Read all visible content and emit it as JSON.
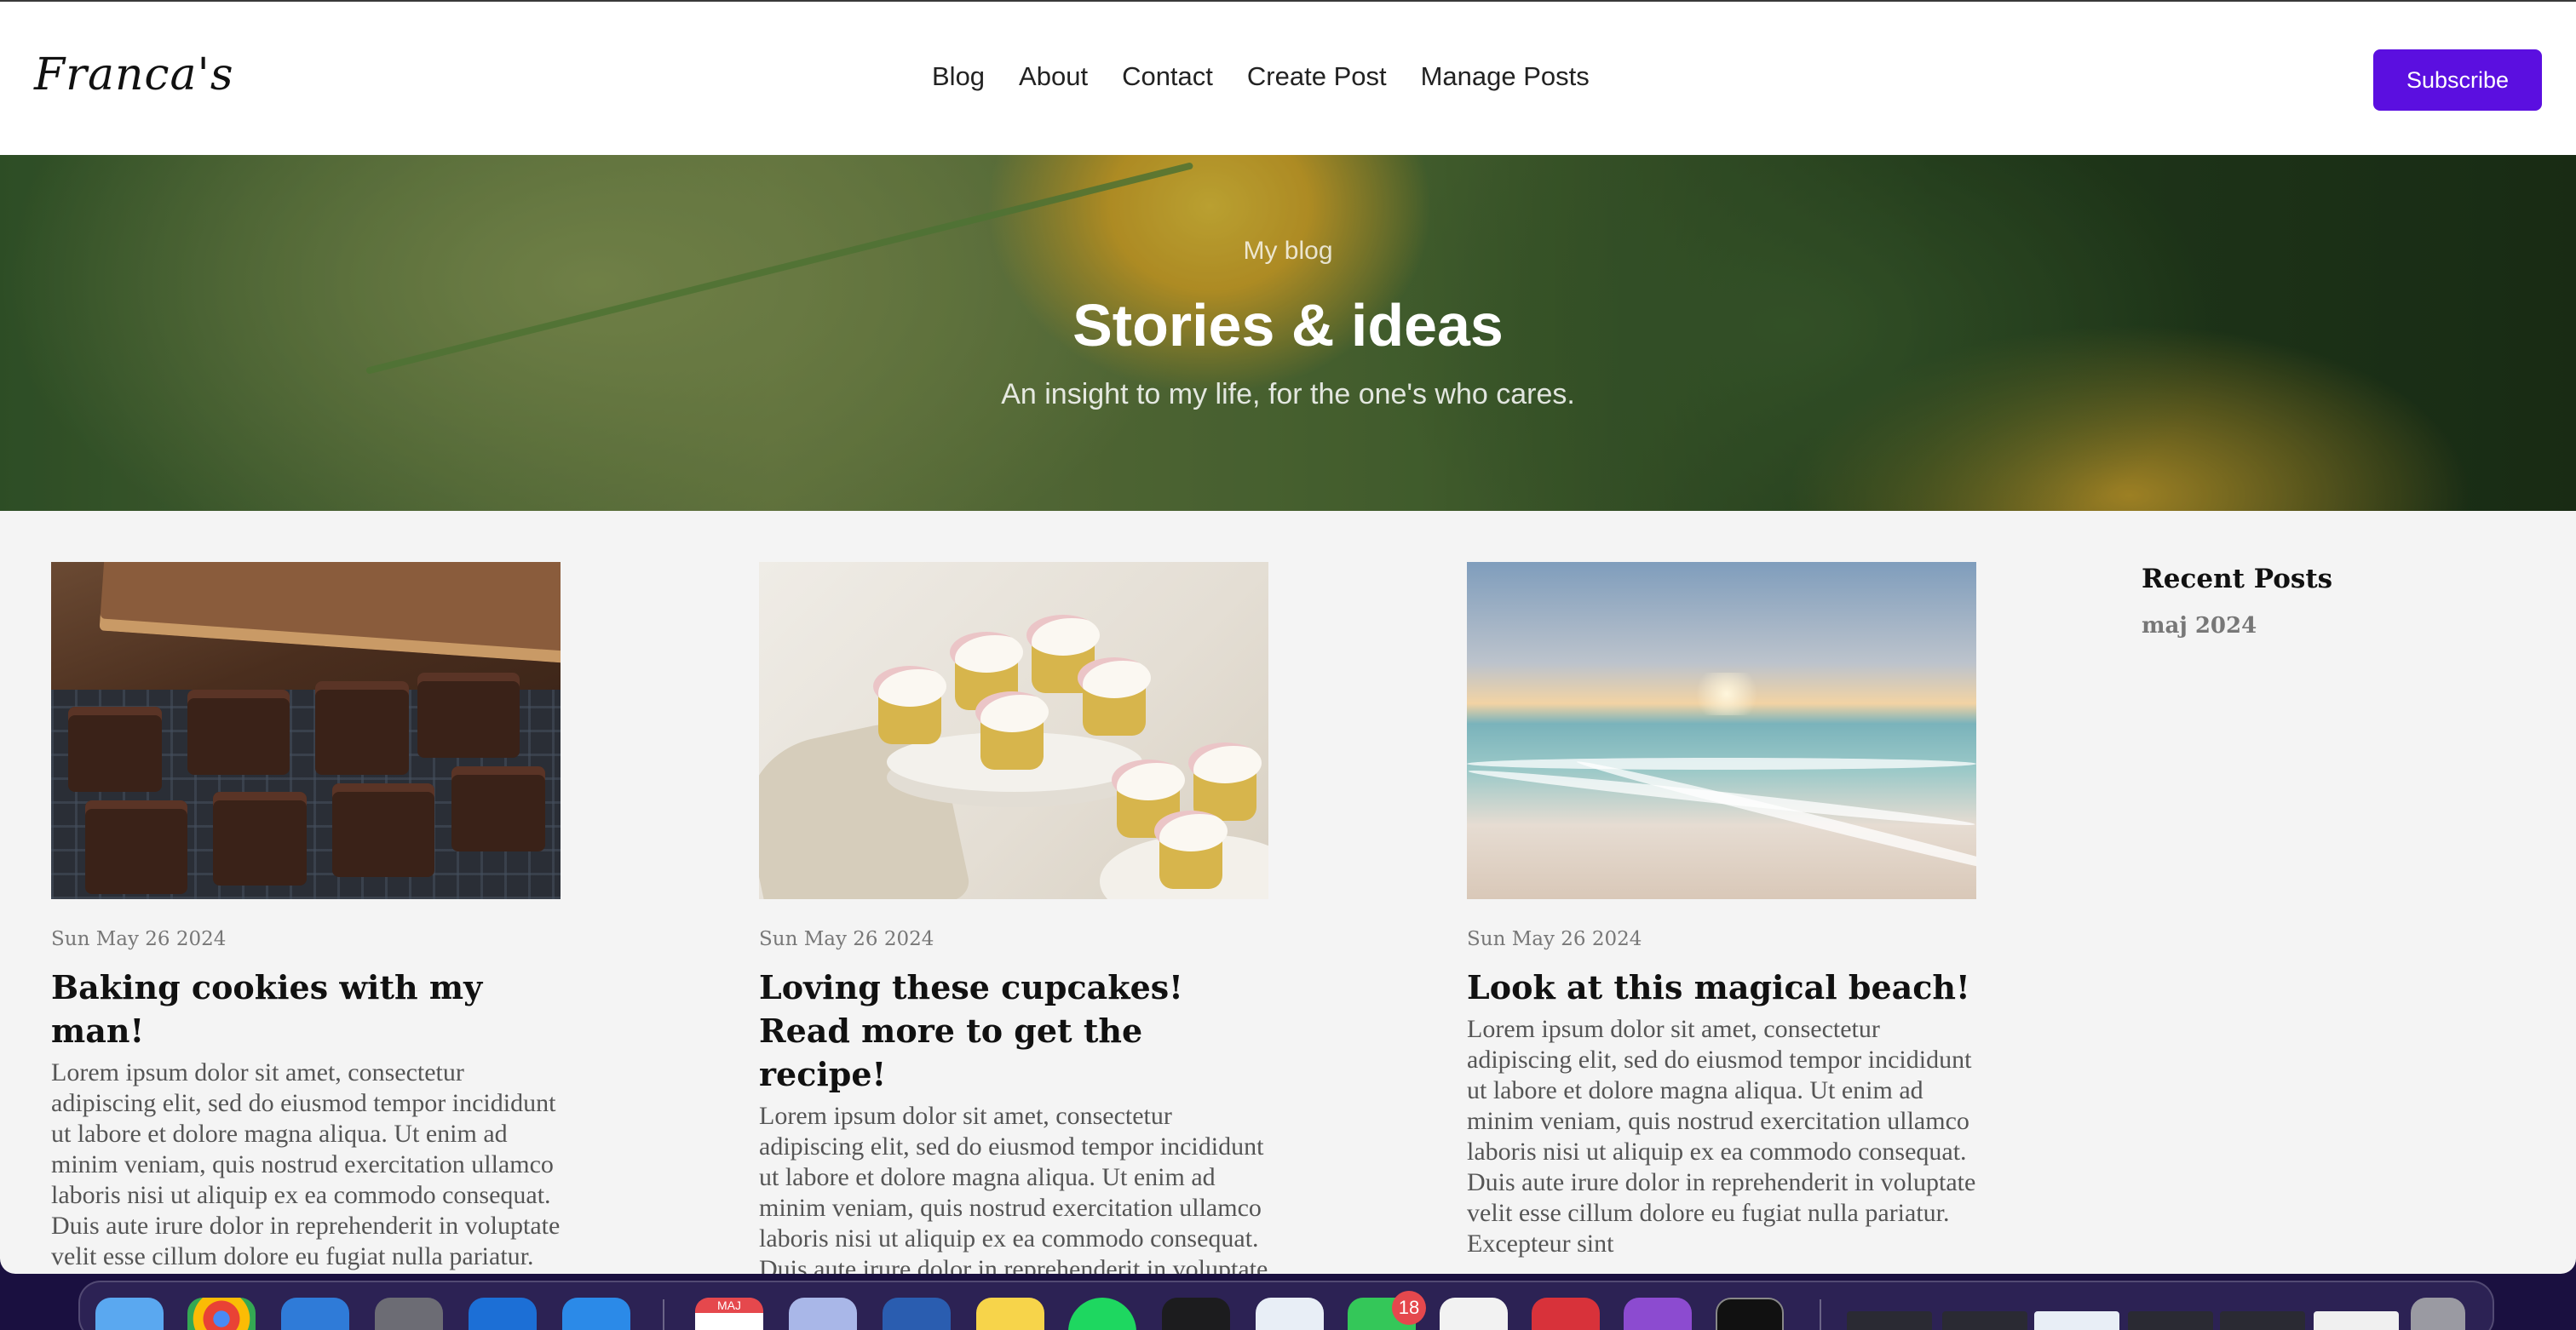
{
  "header": {
    "logo": "Franca's",
    "nav": [
      "Blog",
      "About",
      "Contact",
      "Create Post",
      "Manage Posts"
    ],
    "subscribe_label": "Subscribe"
  },
  "hero": {
    "kicker": "My blog",
    "title": "Stories & ideas",
    "subtitle": "An insight to my life, for the one's who cares."
  },
  "posts": [
    {
      "image": "brownies-photo",
      "date": "Sun May 26 2024",
      "title": "Baking cookies with my man!",
      "excerpt": "Lorem ipsum dolor sit amet, consectetur adipiscing elit, sed do eiusmod tempor incididunt ut labore et dolore magna aliqua. Ut enim ad minim veniam, quis nostrud exercitation ullamco laboris nisi ut aliquip ex ea commodo consequat. Duis aute irure dolor in reprehenderit in voluptate velit esse cillum dolore eu fugiat nulla pariatur. Excepteur sint"
    },
    {
      "image": "cupcakes-photo",
      "date": "Sun May 26 2024",
      "title": "Loving these cupcakes! Read more to get the recipe!",
      "excerpt": "Lorem ipsum dolor sit amet, consectetur adipiscing elit, sed do eiusmod tempor incididunt ut labore et dolore magna aliqua. Ut enim ad minim veniam, quis nostrud exercitation ullamco laboris nisi ut aliquip ex ea commodo consequat. Duis aute irure dolor in reprehenderit in voluptate velit esse cillum"
    },
    {
      "image": "beach-photo",
      "date": "Sun May 26 2024",
      "title": "Look at this magical beach!",
      "excerpt": "Lorem ipsum dolor sit amet, consectetur adipiscing elit, sed do eiusmod tempor incididunt ut labore et dolore magna aliqua. Ut enim ad minim veniam, quis nostrud exercitation ullamco laboris nisi ut aliquip ex ea commodo consequat. Duis aute irure dolor in reprehenderit in voluptate velit esse cillum dolore eu fugiat nulla pariatur. Excepteur sint"
    }
  ],
  "sidebar": {
    "title": "Recent Posts",
    "months": [
      "maj 2024"
    ]
  },
  "dock": {
    "calendar_month": "MAJ",
    "messages_badge": "18"
  },
  "colors": {
    "accent": "#5b0fe0",
    "page_bg": "#f4f4f4"
  }
}
